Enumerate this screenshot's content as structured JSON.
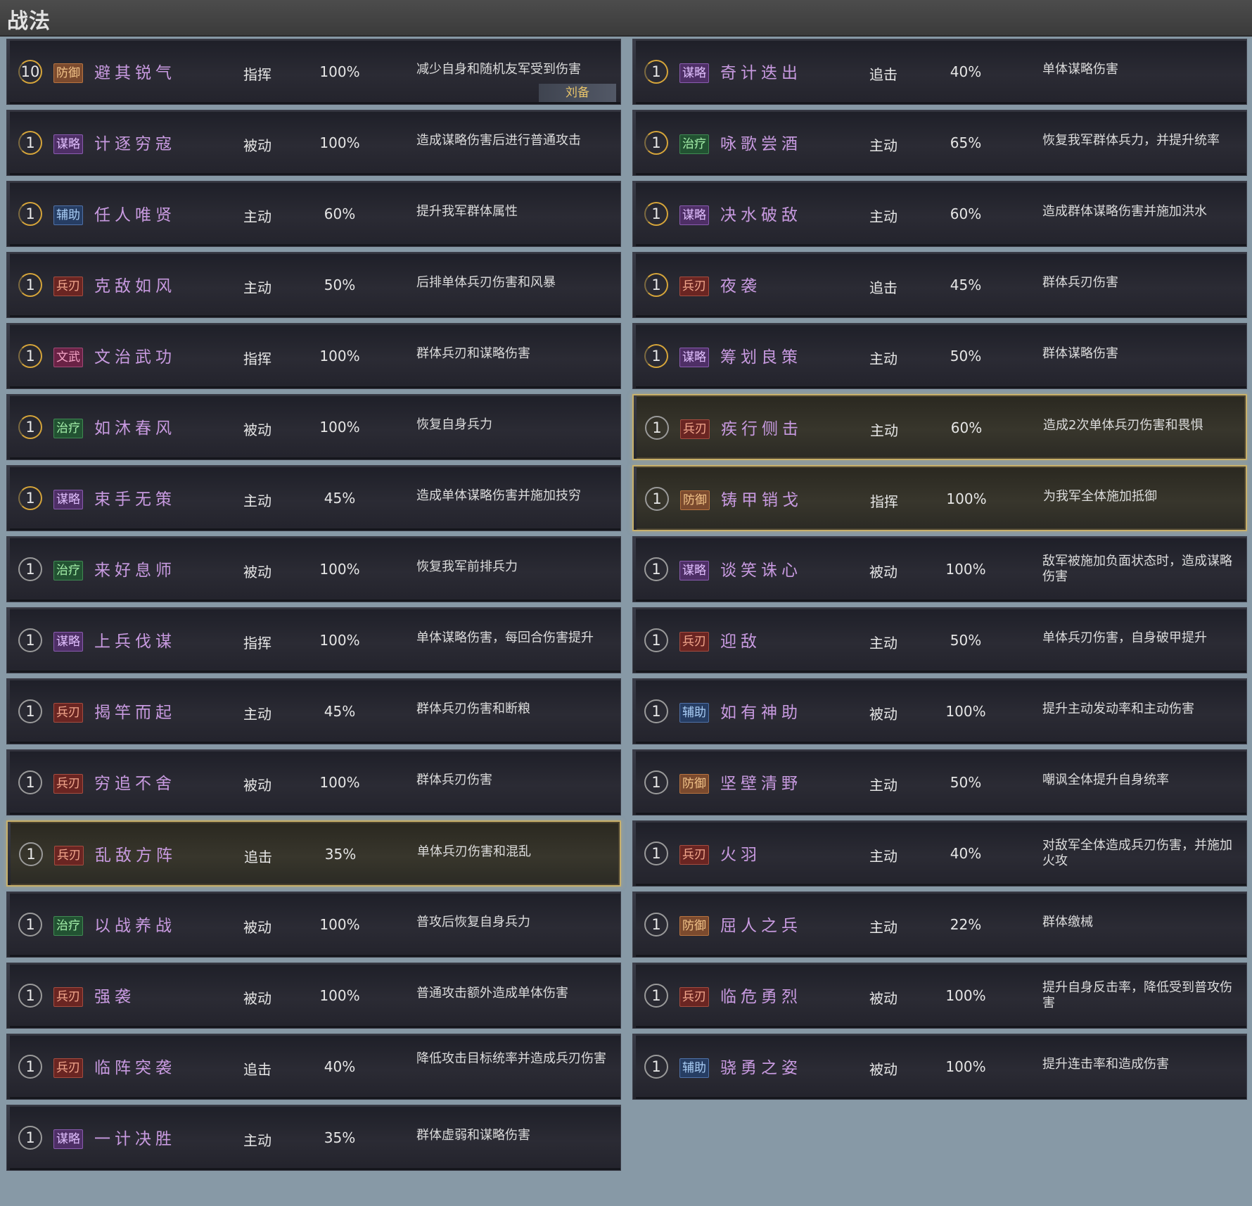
{
  "header": {
    "title": "战法"
  },
  "left": [
    {
      "level": "10",
      "category": "防御",
      "cat": "defense",
      "name": "避其锐气",
      "type": "指挥",
      "rate": "100%",
      "desc": "减少自身和随机友军受到伤害",
      "owner": "刘备",
      "gold": true
    },
    {
      "level": "1",
      "category": "谋略",
      "cat": "strategy",
      "name": "计逐穷寇",
      "type": "被动",
      "rate": "100%",
      "desc": "造成谋略伤害后进行普通攻击",
      "gold": true
    },
    {
      "level": "1",
      "category": "辅助",
      "cat": "support",
      "name": "任人唯贤",
      "type": "主动",
      "rate": "60%",
      "desc": "提升我军群体属性",
      "gold": true
    },
    {
      "level": "1",
      "category": "兵刃",
      "cat": "blade",
      "name": "克敌如风",
      "type": "主动",
      "rate": "50%",
      "desc": "后排单体兵刃伤害和风暴",
      "gold": true
    },
    {
      "level": "1",
      "category": "文武",
      "cat": "civil",
      "name": "文治武功",
      "type": "指挥",
      "rate": "100%",
      "desc": "群体兵刃和谋略伤害",
      "gold": true
    },
    {
      "level": "1",
      "category": "治疗",
      "cat": "heal",
      "name": "如沐春风",
      "type": "被动",
      "rate": "100%",
      "desc": "恢复自身兵力",
      "gold": true
    },
    {
      "level": "1",
      "category": "谋略",
      "cat": "strategy",
      "name": "束手无策",
      "type": "主动",
      "rate": "45%",
      "desc": "造成单体谋略伤害并施加技穷",
      "gold": true
    },
    {
      "level": "1",
      "category": "治疗",
      "cat": "heal",
      "name": "来好息师",
      "type": "被动",
      "rate": "100%",
      "desc": "恢复我军前排兵力"
    },
    {
      "level": "1",
      "category": "谋略",
      "cat": "strategy",
      "name": "上兵伐谋",
      "type": "指挥",
      "rate": "100%",
      "desc": "单体谋略伤害，每回合伤害提升"
    },
    {
      "level": "1",
      "category": "兵刃",
      "cat": "blade",
      "name": "揭竿而起",
      "type": "主动",
      "rate": "45%",
      "desc": "群体兵刃伤害和断粮"
    },
    {
      "level": "1",
      "category": "兵刃",
      "cat": "blade",
      "name": "穷追不舍",
      "type": "被动",
      "rate": "100%",
      "desc": "群体兵刃伤害"
    },
    {
      "level": "1",
      "category": "兵刃",
      "cat": "blade",
      "name": "乱敌方阵",
      "type": "追击",
      "rate": "35%",
      "desc": "单体兵刃伤害和混乱",
      "highlight": true
    },
    {
      "level": "1",
      "category": "治疗",
      "cat": "heal",
      "name": "以战养战",
      "type": "被动",
      "rate": "100%",
      "desc": "普攻后恢复自身兵力"
    },
    {
      "level": "1",
      "category": "兵刃",
      "cat": "blade",
      "name": "强袭",
      "type": "被动",
      "rate": "100%",
      "desc": "普通攻击额外造成单体伤害"
    },
    {
      "level": "1",
      "category": "兵刃",
      "cat": "blade",
      "name": "临阵突袭",
      "type": "追击",
      "rate": "40%",
      "desc": "降低攻击目标统率并造成兵刃伤害",
      "two": true
    },
    {
      "level": "1",
      "category": "谋略",
      "cat": "strategy",
      "name": "一计决胜",
      "type": "主动",
      "rate": "35%",
      "desc": "群体虚弱和谋略伤害"
    }
  ],
  "right": [
    {
      "level": "1",
      "category": "谋略",
      "cat": "strategy",
      "name": "奇计迭出",
      "type": "追击",
      "rate": "40%",
      "desc": "单体谋略伤害",
      "gold": true
    },
    {
      "level": "1",
      "category": "治疗",
      "cat": "heal",
      "name": "咏歌尝酒",
      "type": "主动",
      "rate": "65%",
      "desc": "恢复我军群体兵力，并提升统率",
      "gold": true
    },
    {
      "level": "1",
      "category": "谋略",
      "cat": "strategy",
      "name": "决水破敌",
      "type": "主动",
      "rate": "60%",
      "desc": "造成群体谋略伤害并施加洪水",
      "gold": true
    },
    {
      "level": "1",
      "category": "兵刃",
      "cat": "blade",
      "name": "夜袭",
      "type": "追击",
      "rate": "45%",
      "desc": "群体兵刃伤害",
      "gold": true
    },
    {
      "level": "1",
      "category": "谋略",
      "cat": "strategy",
      "name": "筹划良策",
      "type": "主动",
      "rate": "50%",
      "desc": "群体谋略伤害",
      "gold": true
    },
    {
      "level": "1",
      "category": "兵刃",
      "cat": "blade",
      "name": "疾行侧击",
      "type": "主动",
      "rate": "60%",
      "desc": "造成2次单体兵刃伤害和畏惧",
      "highlight": true
    },
    {
      "level": "1",
      "category": "防御",
      "cat": "defense",
      "name": "铸甲销戈",
      "type": "指挥",
      "rate": "100%",
      "desc": "为我军全体施加抵御",
      "highlight": true
    },
    {
      "level": "1",
      "category": "谋略",
      "cat": "strategy",
      "name": "谈笑诛心",
      "type": "被动",
      "rate": "100%",
      "desc": "敌军被施加负面状态时，造成谋略伤害",
      "two": true
    },
    {
      "level": "1",
      "category": "兵刃",
      "cat": "blade",
      "name": "迎敌",
      "type": "主动",
      "rate": "50%",
      "desc": "单体兵刃伤害，自身破甲提升"
    },
    {
      "level": "1",
      "category": "辅助",
      "cat": "support",
      "name": "如有神助",
      "type": "被动",
      "rate": "100%",
      "desc": "提升主动发动率和主动伤害"
    },
    {
      "level": "1",
      "category": "防御",
      "cat": "defense",
      "name": "坚壁清野",
      "type": "主动",
      "rate": "50%",
      "desc": "嘲讽全体提升自身统率"
    },
    {
      "level": "1",
      "category": "兵刃",
      "cat": "blade",
      "name": "火羽",
      "type": "主动",
      "rate": "40%",
      "desc": "对敌军全体造成兵刃伤害，并施加火攻",
      "two": true
    },
    {
      "level": "1",
      "category": "防御",
      "cat": "defense",
      "name": "屈人之兵",
      "type": "主动",
      "rate": "22%",
      "desc": "群体缴械"
    },
    {
      "level": "1",
      "category": "兵刃",
      "cat": "blade",
      "name": "临危勇烈",
      "type": "被动",
      "rate": "100%",
      "desc": "提升自身反击率，降低受到普攻伤害",
      "two": true
    },
    {
      "level": "1",
      "category": "辅助",
      "cat": "support",
      "name": "骁勇之姿",
      "type": "被动",
      "rate": "100%",
      "desc": "提升连击率和造成伤害"
    }
  ]
}
